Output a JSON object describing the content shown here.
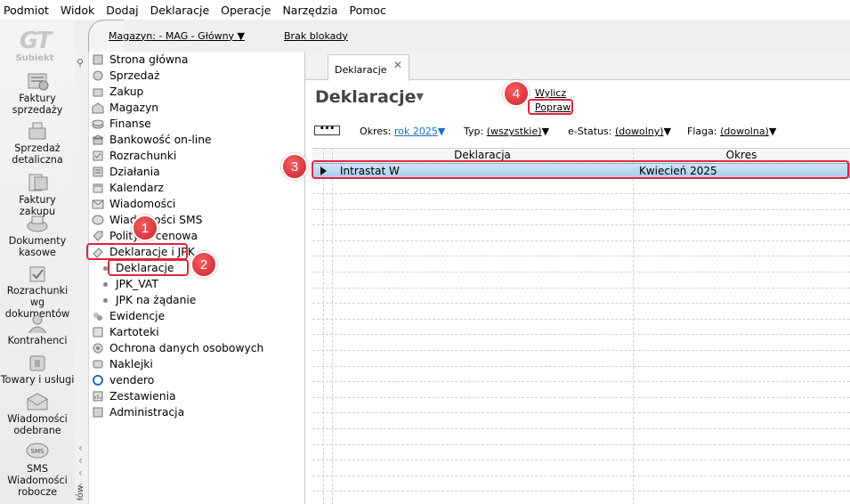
{
  "menu": [
    "Podmiot",
    "Widok",
    "Dodaj",
    "Deklaracje",
    "Operacje",
    "Narzędzia",
    "Pomoc"
  ],
  "logo_text": "Subiekt",
  "modules": [
    {
      "label": "Faktury sprzedaży",
      "icon": "invoice-stack-icon"
    },
    {
      "label": "Sprzedaż detaliczna",
      "icon": "cash-register-icon"
    },
    {
      "label": "Faktury zakupu",
      "icon": "purchase-invoice-icon"
    },
    {
      "label": "Dokumenty kasowe",
      "icon": "cash-documents-icon"
    },
    {
      "label": "Rozrachunki wg dokumentów",
      "icon": "settlements-icon"
    },
    {
      "label": "Kontrahenci",
      "icon": "contractor-icon"
    },
    {
      "label": "Towary i usługi",
      "icon": "goods-icon"
    },
    {
      "label": "Wiadomości odebrane",
      "icon": "received-messages-icon"
    },
    {
      "label": "SMS Wiadomości robocze",
      "icon": "sms-icon"
    }
  ],
  "topbar": {
    "magazyn": "Magazyn: - MAG - Główny",
    "blokada": "Brak blokady"
  },
  "nav": {
    "side_label": "łów",
    "items": [
      {
        "label": "Strona główna",
        "icon": "home-icon"
      },
      {
        "label": "Sprzedaż",
        "icon": "sales-icon"
      },
      {
        "label": "Zakup",
        "icon": "purchase-icon"
      },
      {
        "label": "Magazyn",
        "icon": "warehouse-icon"
      },
      {
        "label": "Finanse",
        "icon": "finance-icon"
      },
      {
        "label": "Bankowość on-line",
        "icon": "bank-icon"
      },
      {
        "label": "Rozrachunki",
        "icon": "settlements-icon"
      },
      {
        "label": "Działania",
        "icon": "actions-icon"
      },
      {
        "label": "Kalendarz",
        "icon": "calendar-icon"
      },
      {
        "label": "Wiadomości",
        "icon": "messages-icon"
      },
      {
        "label": "Wiadomości SMS",
        "icon": "sms-icon"
      },
      {
        "label": "Polityka cenowa",
        "icon": "pricing-icon"
      },
      {
        "label": "Deklaracje i JPK",
        "icon": "declarations-icon"
      }
    ],
    "subitems": [
      "Deklaracje",
      "JPK_VAT",
      "JPK na żądanie"
    ],
    "items2": [
      {
        "label": "Ewidencje",
        "icon": "records-icon"
      },
      {
        "label": "Kartoteki",
        "icon": "files-icon"
      },
      {
        "label": "Ochrona danych osobowych",
        "icon": "data-protection-icon"
      },
      {
        "label": "Naklejki",
        "icon": "stickers-icon"
      },
      {
        "label": "vendero",
        "icon": "vendero-icon"
      },
      {
        "label": "Zestawienia",
        "icon": "reports-icon"
      },
      {
        "label": "Administracja",
        "icon": "admin-icon"
      }
    ]
  },
  "tab": {
    "label": "Deklaracje",
    "close": "✕"
  },
  "page": {
    "title": "Deklaracje",
    "actions": {
      "wylicz": "Wylicz",
      "popraw": "Popraw"
    }
  },
  "filters": {
    "dots": "•••",
    "okres_label": "Okres:",
    "okres_value": "rok 2025",
    "typ_label": "Typ:",
    "typ_value": "(wszystkie)",
    "estatus_label": "e-Status:",
    "estatus_value": "(dowolny)",
    "flaga_label": "Flaga:",
    "flaga_value": "(dowolna)"
  },
  "grid": {
    "columns": [
      "Deklaracja",
      "Okres"
    ],
    "rows": [
      {
        "deklaracja": "Intrastat W",
        "okres": "Kwiecień 2025"
      }
    ]
  },
  "callouts": [
    "1",
    "2",
    "3",
    "4"
  ],
  "colors": {
    "accent": "#e0263a",
    "selection": "#a9cdee",
    "link_blue": "#1a6fc0"
  }
}
